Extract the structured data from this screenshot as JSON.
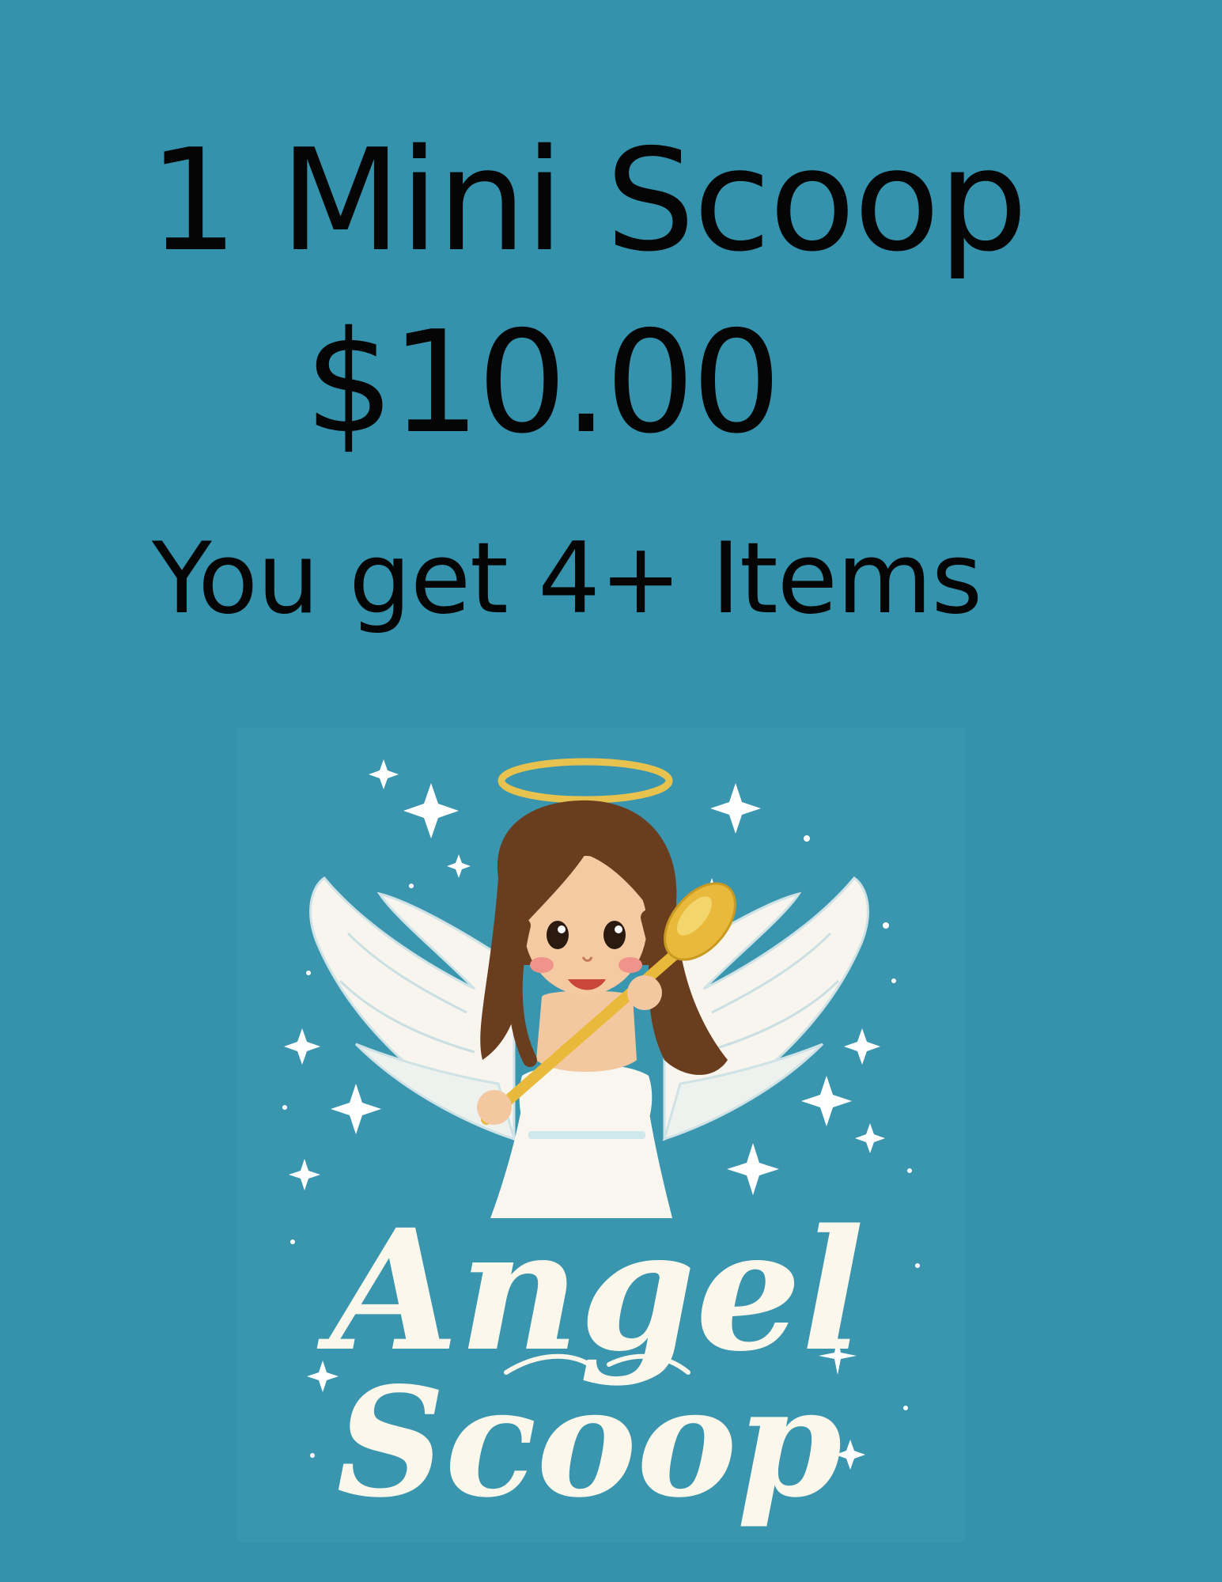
{
  "flyer": {
    "title": "1 Mini Scoop",
    "price": "$10.00",
    "subtitle": "You get 4+ Items"
  },
  "logo": {
    "word_top": "Angel",
    "word_bottom": "Scoop",
    "icons": [
      "angel-girl-icon",
      "halo-icon",
      "wing-icon",
      "golden-spoon-icon",
      "sparkle-star-icon"
    ]
  },
  "colors": {
    "background": "#3592ac",
    "text": "#050505",
    "logo_text": "#fbf7ea",
    "halo": "#e7c24f",
    "spoon": "#e8b93a",
    "hair": "#6b3d1f"
  }
}
